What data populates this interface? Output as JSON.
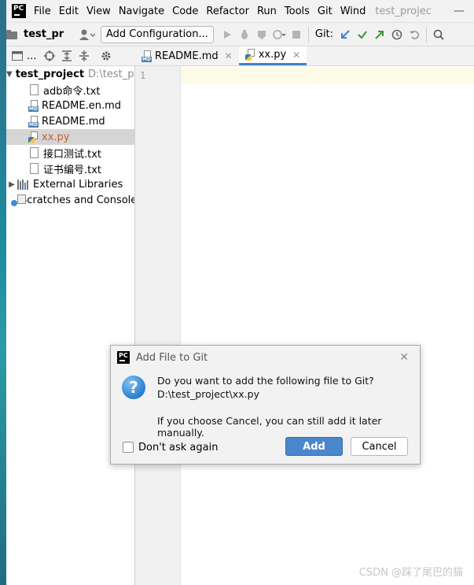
{
  "menubar": {
    "logo": "PC",
    "items": [
      "File",
      "Edit",
      "View",
      "Navigate",
      "Code",
      "Refactor",
      "Run",
      "Tools",
      "Git",
      "Wind"
    ],
    "window_title": "test_projec",
    "minimize_glyph": "—"
  },
  "toolbar": {
    "project_name": "test_pr",
    "add_config_label": "Add Configuration...",
    "git_label": "Git:"
  },
  "project_panel": {
    "header_label": "...",
    "root": {
      "name": "test_project",
      "path": "D:\\test_project"
    },
    "files": [
      {
        "name": "adb命令.txt",
        "icon": "text-file-icon"
      },
      {
        "name": "README.en.md",
        "icon": "markdown-file-icon"
      },
      {
        "name": "README.md",
        "icon": "markdown-file-icon"
      },
      {
        "name": "xx.py",
        "icon": "python-file-icon"
      },
      {
        "name": "接口测试.txt",
        "icon": "text-file-icon"
      },
      {
        "name": "证书编号.txt",
        "icon": "text-file-icon"
      }
    ],
    "external_libraries": "External Libraries",
    "scratches": "Scratches and Consoles",
    "md_tag": "MD"
  },
  "editor": {
    "tabs": [
      {
        "label": "README.md",
        "active": false
      },
      {
        "label": "xx.py",
        "active": true
      }
    ],
    "line_number": "1"
  },
  "dialog": {
    "title": "Add File to Git",
    "message_line1": "Do you want to add the following file to Git?",
    "message_line2": "D:\\test_project\\xx.py",
    "message_line3": "If you choose Cancel, you can still add it later manually.",
    "checkbox_label": "Don't ask again",
    "add_label": "Add",
    "cancel_label": "Cancel",
    "question_glyph": "?"
  },
  "watermark": "CSDN @踩了尾巴的猫",
  "colors": {
    "accent_blue": "#4a87cc",
    "tab_underline": "#4083c9",
    "selected_row": "#d5d5d5",
    "current_line": "#fdfbe6"
  }
}
